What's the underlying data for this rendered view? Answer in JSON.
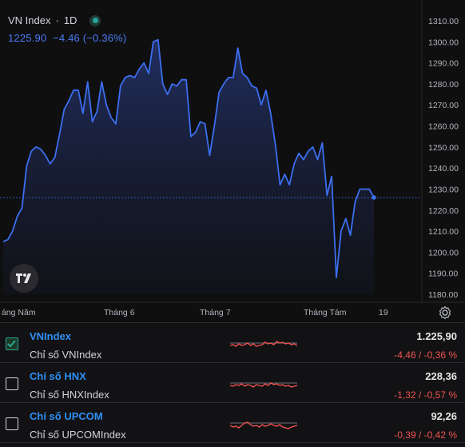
{
  "header": {
    "symbol": "VN Index",
    "separator": "·",
    "interval": "1D",
    "last": "1225.90",
    "change": "−4.46 (−0.36%)"
  },
  "colors": {
    "background": "#0f0f10",
    "line": "#3b6ff0",
    "accent": "#4c7bf3",
    "down": "#ef5350",
    "link": "#2f8ff5",
    "live": "#26a69a"
  },
  "chart_data": {
    "type": "area",
    "yticks": [
      "1310.00",
      "1300.00",
      "1290.00",
      "1280.00",
      "1270.00",
      "1260.00",
      "1250.00",
      "1240.00",
      "1230.00",
      "1220.00",
      "1210.00",
      "1200.00",
      "1190.00",
      "1180.00"
    ],
    "ylim": [
      1180,
      1310
    ],
    "xticks": [
      "áng Năm",
      "Tháng 6",
      "Tháng 7",
      "Tháng Tám",
      "19"
    ],
    "last_price_line": 1225.9,
    "values": [
      1205,
      1206,
      1210,
      1217,
      1221,
      1241,
      1248,
      1250,
      1249,
      1246,
      1242,
      1245,
      1256,
      1268,
      1272,
      1277,
      1277,
      1266,
      1281,
      1262,
      1267,
      1281,
      1270,
      1264,
      1261,
      1279,
      1283,
      1284,
      1283,
      1287,
      1290,
      1285,
      1300,
      1301,
      1280,
      1275,
      1280,
      1279,
      1282,
      1282,
      1255,
      1257,
      1262,
      1261,
      1246,
      1260,
      1276,
      1280,
      1283,
      1283,
      1297,
      1285,
      1283,
      1279,
      1278,
      1270,
      1277,
      1266,
      1251,
      1232,
      1237,
      1232,
      1242,
      1247,
      1244,
      1248,
      1250,
      1244,
      1252,
      1227,
      1236,
      1188,
      1210,
      1216,
      1208,
      1224,
      1230,
      1230,
      1230,
      1226
    ]
  },
  "rows": [
    {
      "name": "VNIndex",
      "desc": "Chỉ số VNIndex",
      "value": "1.225,90",
      "change": "-4,46 / -0,36 %",
      "checked": true
    },
    {
      "name": "Chỉ số HNX",
      "desc": "Chỉ số HNXIndex",
      "value": "228,36",
      "change": "-1,32 / -0,57 %",
      "checked": false
    },
    {
      "name": "Chỉ số UPCOM",
      "desc": "Chỉ số UPCOMIndex",
      "value": "92,26",
      "change": "-0,39 / -0,42 %",
      "checked": false
    }
  ],
  "icons": {
    "logo": "tradingview-logo-icon",
    "settings": "gear-icon",
    "check": "check-icon"
  }
}
